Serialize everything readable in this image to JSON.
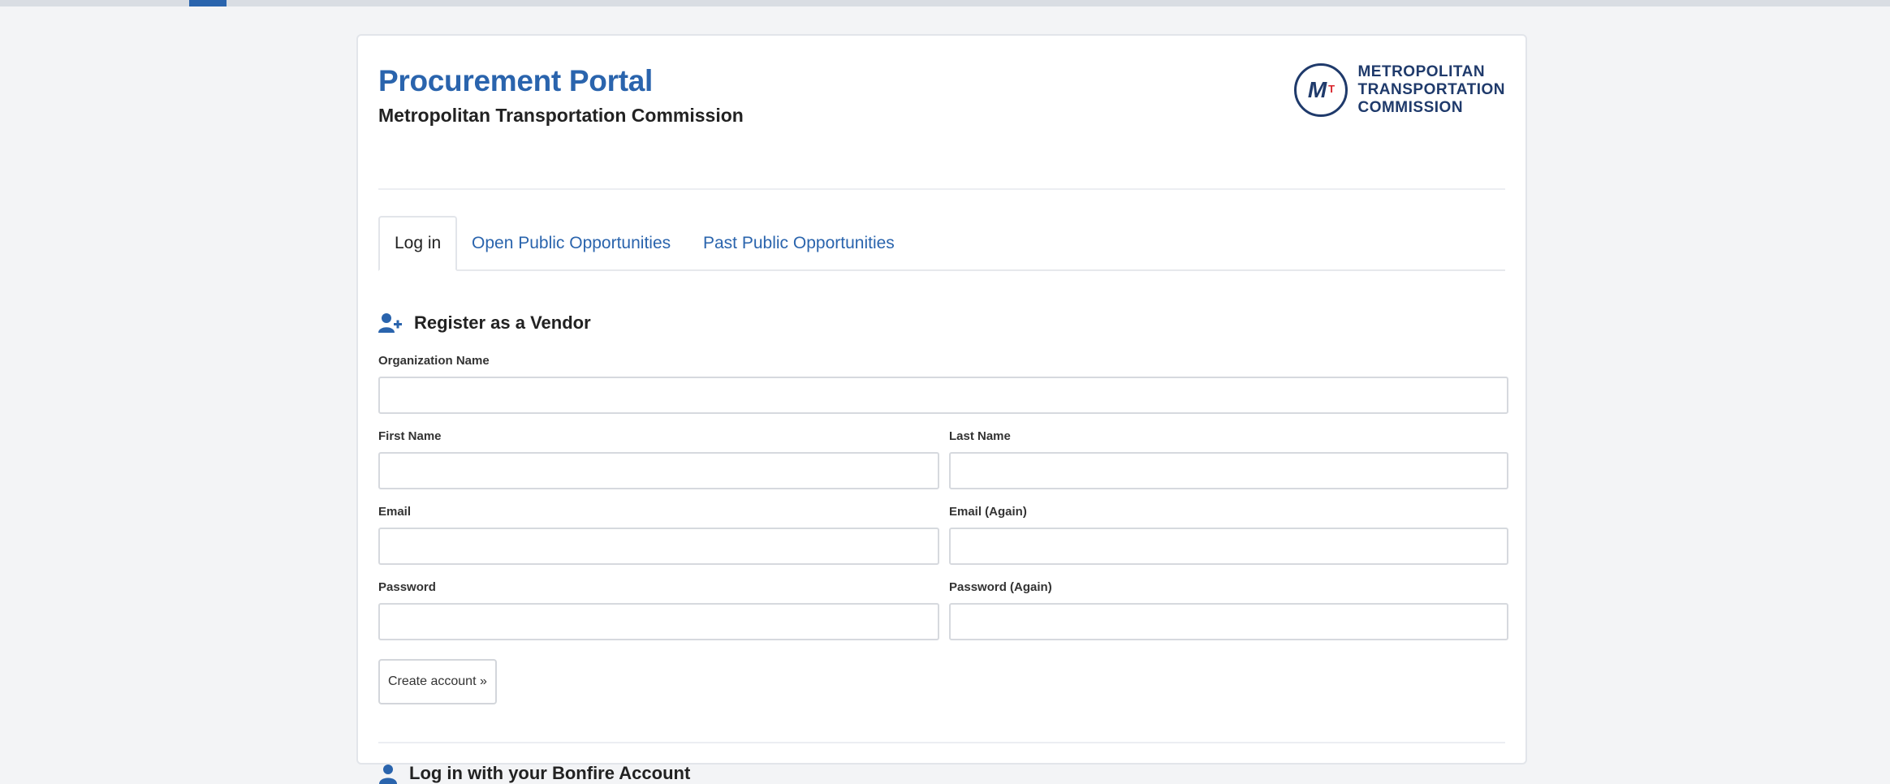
{
  "header": {
    "title": "Procurement Portal",
    "subtitle": "Metropolitan Transportation Commission"
  },
  "logo": {
    "mark_letter": "M",
    "mark_small": "T",
    "line1": "METROPOLITAN",
    "line2": "TRANSPORTATION",
    "line3": "COMMISSION"
  },
  "tabs": [
    {
      "label": "Log in",
      "active": true
    },
    {
      "label": "Open Public Opportunities",
      "active": false
    },
    {
      "label": "Past Public Opportunities",
      "active": false
    }
  ],
  "register": {
    "title": "Register as a Vendor",
    "icon": "add-user-icon",
    "fields": {
      "organization_name": {
        "label": "Organization Name",
        "value": ""
      },
      "first_name": {
        "label": "First Name",
        "value": ""
      },
      "last_name": {
        "label": "Last Name",
        "value": ""
      },
      "email": {
        "label": "Email",
        "value": ""
      },
      "email_again": {
        "label": "Email (Again)",
        "value": ""
      },
      "password": {
        "label": "Password",
        "value": ""
      },
      "password_again": {
        "label": "Password (Again)",
        "value": ""
      }
    },
    "submit_label": "Create account »"
  },
  "login": {
    "title": "Log in with your Bonfire Account",
    "icon": "user-icon"
  },
  "colors": {
    "brand_blue": "#2a64ad",
    "logo_navy": "#1f3a6b",
    "logo_red": "#d8232a"
  }
}
